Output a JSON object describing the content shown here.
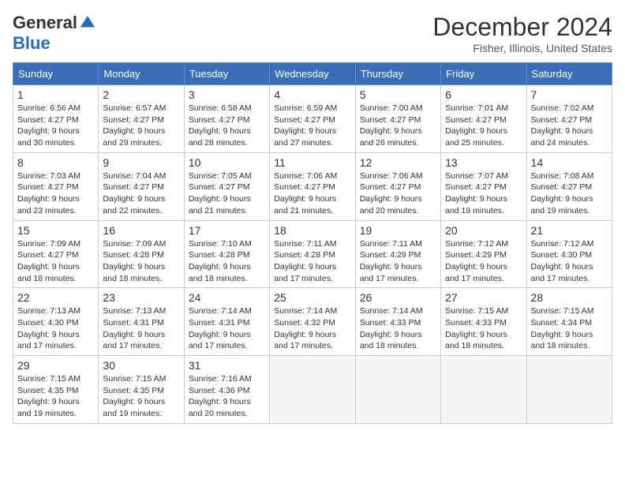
{
  "logo": {
    "general": "General",
    "blue": "Blue"
  },
  "title": "December 2024",
  "location": "Fisher, Illinois, United States",
  "days_of_week": [
    "Sunday",
    "Monday",
    "Tuesday",
    "Wednesday",
    "Thursday",
    "Friday",
    "Saturday"
  ],
  "weeks": [
    [
      {
        "day": "1",
        "sunrise": "6:56 AM",
        "sunset": "4:27 PM",
        "daylight": "9 hours and 30 minutes."
      },
      {
        "day": "2",
        "sunrise": "6:57 AM",
        "sunset": "4:27 PM",
        "daylight": "9 hours and 29 minutes."
      },
      {
        "day": "3",
        "sunrise": "6:58 AM",
        "sunset": "4:27 PM",
        "daylight": "9 hours and 28 minutes."
      },
      {
        "day": "4",
        "sunrise": "6:59 AM",
        "sunset": "4:27 PM",
        "daylight": "9 hours and 27 minutes."
      },
      {
        "day": "5",
        "sunrise": "7:00 AM",
        "sunset": "4:27 PM",
        "daylight": "9 hours and 26 minutes."
      },
      {
        "day": "6",
        "sunrise": "7:01 AM",
        "sunset": "4:27 PM",
        "daylight": "9 hours and 25 minutes."
      },
      {
        "day": "7",
        "sunrise": "7:02 AM",
        "sunset": "4:27 PM",
        "daylight": "9 hours and 24 minutes."
      }
    ],
    [
      {
        "day": "8",
        "sunrise": "7:03 AM",
        "sunset": "4:27 PM",
        "daylight": "9 hours and 23 minutes."
      },
      {
        "day": "9",
        "sunrise": "7:04 AM",
        "sunset": "4:27 PM",
        "daylight": "9 hours and 22 minutes."
      },
      {
        "day": "10",
        "sunrise": "7:05 AM",
        "sunset": "4:27 PM",
        "daylight": "9 hours and 21 minutes."
      },
      {
        "day": "11",
        "sunrise": "7:06 AM",
        "sunset": "4:27 PM",
        "daylight": "9 hours and 21 minutes."
      },
      {
        "day": "12",
        "sunrise": "7:06 AM",
        "sunset": "4:27 PM",
        "daylight": "9 hours and 20 minutes."
      },
      {
        "day": "13",
        "sunrise": "7:07 AM",
        "sunset": "4:27 PM",
        "daylight": "9 hours and 19 minutes."
      },
      {
        "day": "14",
        "sunrise": "7:08 AM",
        "sunset": "4:27 PM",
        "daylight": "9 hours and 19 minutes."
      }
    ],
    [
      {
        "day": "15",
        "sunrise": "7:09 AM",
        "sunset": "4:27 PM",
        "daylight": "9 hours and 18 minutes."
      },
      {
        "day": "16",
        "sunrise": "7:09 AM",
        "sunset": "4:28 PM",
        "daylight": "9 hours and 18 minutes."
      },
      {
        "day": "17",
        "sunrise": "7:10 AM",
        "sunset": "4:28 PM",
        "daylight": "9 hours and 18 minutes."
      },
      {
        "day": "18",
        "sunrise": "7:11 AM",
        "sunset": "4:28 PM",
        "daylight": "9 hours and 17 minutes."
      },
      {
        "day": "19",
        "sunrise": "7:11 AM",
        "sunset": "4:29 PM",
        "daylight": "9 hours and 17 minutes."
      },
      {
        "day": "20",
        "sunrise": "7:12 AM",
        "sunset": "4:29 PM",
        "daylight": "9 hours and 17 minutes."
      },
      {
        "day": "21",
        "sunrise": "7:12 AM",
        "sunset": "4:30 PM",
        "daylight": "9 hours and 17 minutes."
      }
    ],
    [
      {
        "day": "22",
        "sunrise": "7:13 AM",
        "sunset": "4:30 PM",
        "daylight": "9 hours and 17 minutes."
      },
      {
        "day": "23",
        "sunrise": "7:13 AM",
        "sunset": "4:31 PM",
        "daylight": "9 hours and 17 minutes."
      },
      {
        "day": "24",
        "sunrise": "7:14 AM",
        "sunset": "4:31 PM",
        "daylight": "9 hours and 17 minutes."
      },
      {
        "day": "25",
        "sunrise": "7:14 AM",
        "sunset": "4:32 PM",
        "daylight": "9 hours and 17 minutes."
      },
      {
        "day": "26",
        "sunrise": "7:14 AM",
        "sunset": "4:33 PM",
        "daylight": "9 hours and 18 minutes."
      },
      {
        "day": "27",
        "sunrise": "7:15 AM",
        "sunset": "4:33 PM",
        "daylight": "9 hours and 18 minutes."
      },
      {
        "day": "28",
        "sunrise": "7:15 AM",
        "sunset": "4:34 PM",
        "daylight": "9 hours and 18 minutes."
      }
    ],
    [
      {
        "day": "29",
        "sunrise": "7:15 AM",
        "sunset": "4:35 PM",
        "daylight": "9 hours and 19 minutes."
      },
      {
        "day": "30",
        "sunrise": "7:15 AM",
        "sunset": "4:35 PM",
        "daylight": "9 hours and 19 minutes."
      },
      {
        "day": "31",
        "sunrise": "7:16 AM",
        "sunset": "4:36 PM",
        "daylight": "9 hours and 20 minutes."
      },
      null,
      null,
      null,
      null
    ]
  ],
  "labels": {
    "sunrise": "Sunrise:",
    "sunset": "Sunset:",
    "daylight": "Daylight:"
  }
}
